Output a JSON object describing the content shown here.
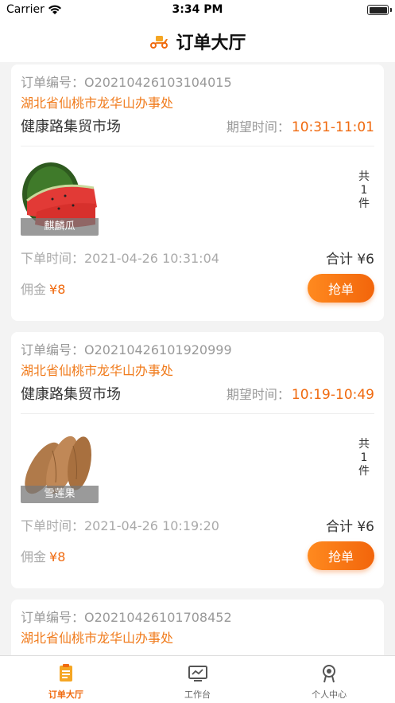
{
  "status_bar": {
    "carrier": "Carrier",
    "time": "3:34 PM"
  },
  "nav": {
    "title": "订单大厅",
    "icon": "scooter-icon"
  },
  "orders": [
    {
      "order_no": "订单编号：O20210426103104015",
      "address": "湖北省仙桃市龙华山办事处",
      "market": "健康路集贸市场",
      "expect_label": "期望时间：",
      "expect_time": "10:31-11:01",
      "goods_name": "麒麟瓜",
      "qty_prefix": "共",
      "qty": "1",
      "qty_suffix": "件",
      "order_time": "下单时间：2021-04-26 10:31:04",
      "total_label": "合计",
      "total": "¥6",
      "commission_label": "佣金",
      "commission": "¥8",
      "grab_label": "抢单"
    },
    {
      "order_no": "订单编号：O20210426101920999",
      "address": "湖北省仙桃市龙华山办事处",
      "market": "健康路集贸市场",
      "expect_label": "期望时间：",
      "expect_time": "10:19-10:49",
      "goods_name": "雪莲果",
      "qty_prefix": "共",
      "qty": "1",
      "qty_suffix": "件",
      "order_time": "下单时间：2021-04-26 10:19:20",
      "total_label": "合计",
      "total": "¥6",
      "commission_label": "佣金",
      "commission": "¥8",
      "grab_label": "抢单"
    },
    {
      "order_no": "订单编号：O20210426101708452",
      "address": "湖北省仙桃市龙华山办事处"
    }
  ],
  "tabs": [
    {
      "label": "订单大厅",
      "icon": "order-list-icon",
      "active": true
    },
    {
      "label": "工作台",
      "icon": "workbench-monitor-icon",
      "active": false
    },
    {
      "label": "个人中心",
      "icon": "profile-icon",
      "active": false
    }
  ],
  "colors": {
    "accent": "#f06a0f",
    "address": "#f07b1c",
    "background": "#f3f3f3"
  }
}
